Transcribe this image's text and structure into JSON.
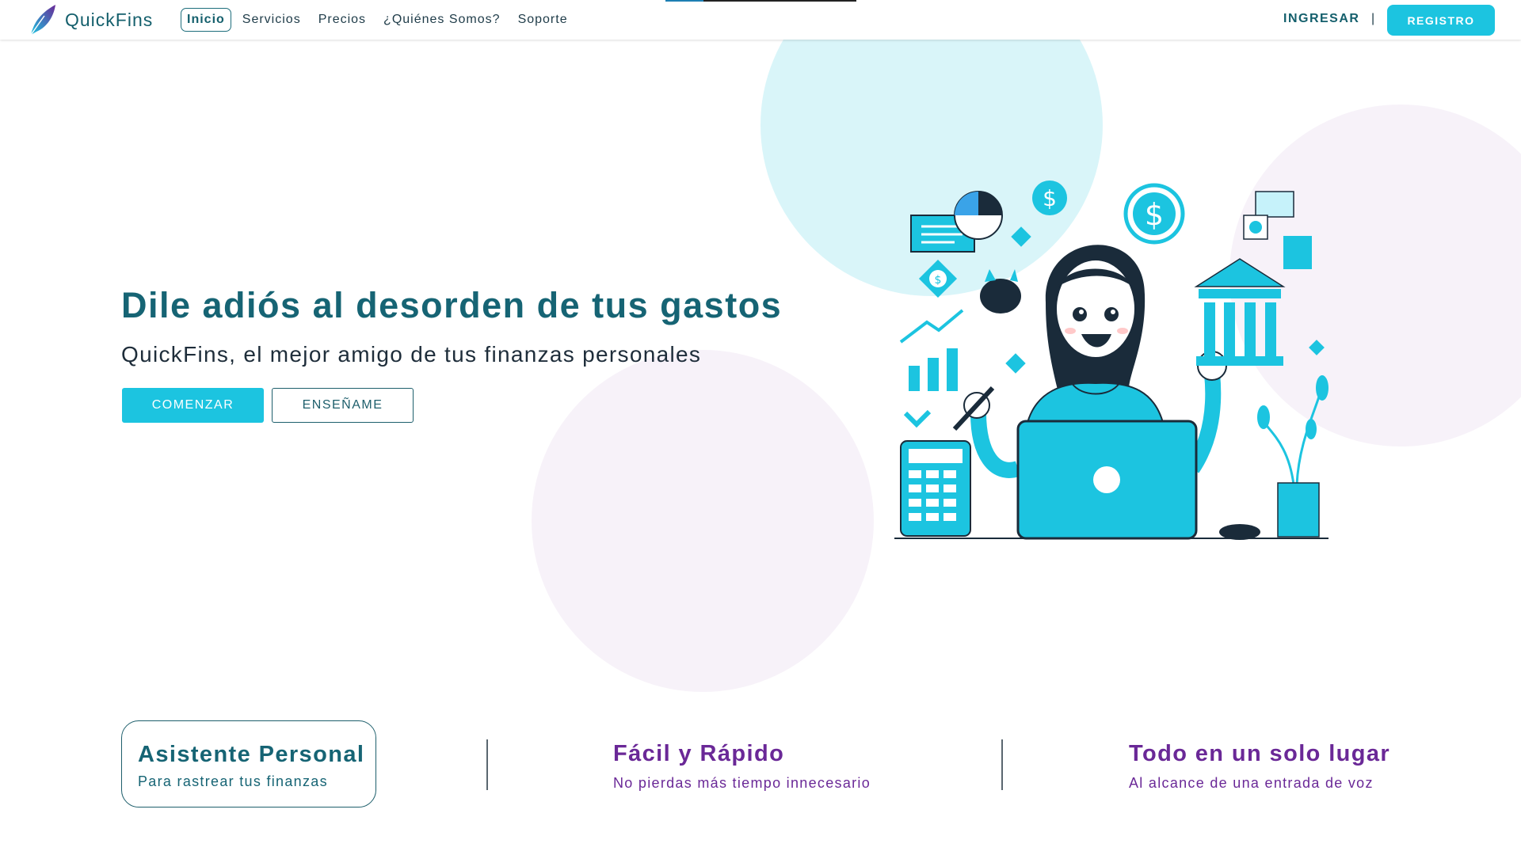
{
  "header": {
    "brand": "QuickFins",
    "nav": [
      "Inicio",
      "Servicios",
      "Precios",
      "¿Quiénes Somos?",
      "Soporte"
    ],
    "login": "INGRESAR",
    "separator": "|",
    "register": "REGISTRO",
    "page_progress": 0.2
  },
  "hero": {
    "title": "Dile adiós al desorden de tus gastos",
    "subtitle": "QuickFins, el mejor amigo de tus finanzas personales",
    "primary_button": "COMENZAR",
    "secondary_button": "ENSEÑAME"
  },
  "features": [
    {
      "title": "Asistente Personal",
      "subtitle": "Para rastrear tus finanzas"
    },
    {
      "title": "Fácil y Rápido",
      "subtitle": "No pierdas más tiempo innecesario"
    },
    {
      "title": "Todo en un solo lugar",
      "subtitle": "Al alcance de una entrada de voz"
    }
  ],
  "colors": {
    "accent": "#1cc4e0",
    "teal_text": "#166474",
    "purple_text": "#6a2897",
    "circle_cyan": "#d9f5f9",
    "circle_lavender": "#f7f2f9"
  },
  "icons": [
    "feather-logo-icon"
  ]
}
